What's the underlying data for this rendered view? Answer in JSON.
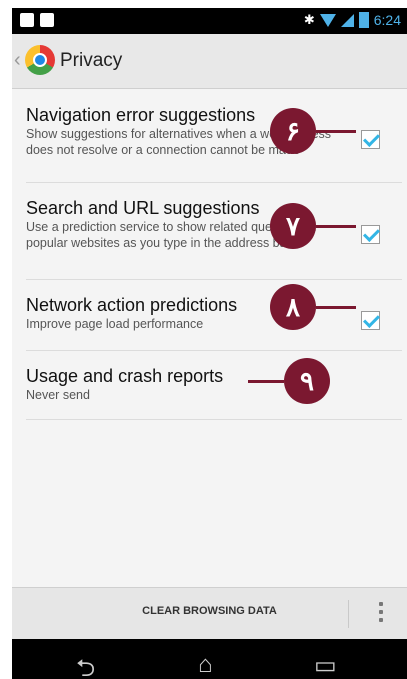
{
  "statusbar": {
    "time": "6:24",
    "bluetooth": "✱"
  },
  "header": {
    "title": "Privacy"
  },
  "items": [
    {
      "title": "Navigation error suggestions",
      "summary": "Show suggestions for alternatives when a web address does not resolve or a connection cannot be made",
      "checked": true,
      "callout": "۶"
    },
    {
      "title": "Search and URL suggestions",
      "summary": "Use a prediction service to show related queries and popular websites as you type in the address bar",
      "checked": true,
      "callout": "۷"
    },
    {
      "title": "Network action predictions",
      "summary": "Improve page load performance",
      "checked": true,
      "callout": "۸"
    },
    {
      "title": "Usage and crash reports",
      "summary": "Never send",
      "checked": false,
      "callout": "۹"
    }
  ],
  "bottom": {
    "clear_label": "CLEAR BROWSING DATA"
  },
  "nav": {
    "back": "⮌",
    "home": "⌂",
    "recents": "▭"
  },
  "colors": {
    "accent": "#33b5e5",
    "callout": "#7b1830"
  }
}
